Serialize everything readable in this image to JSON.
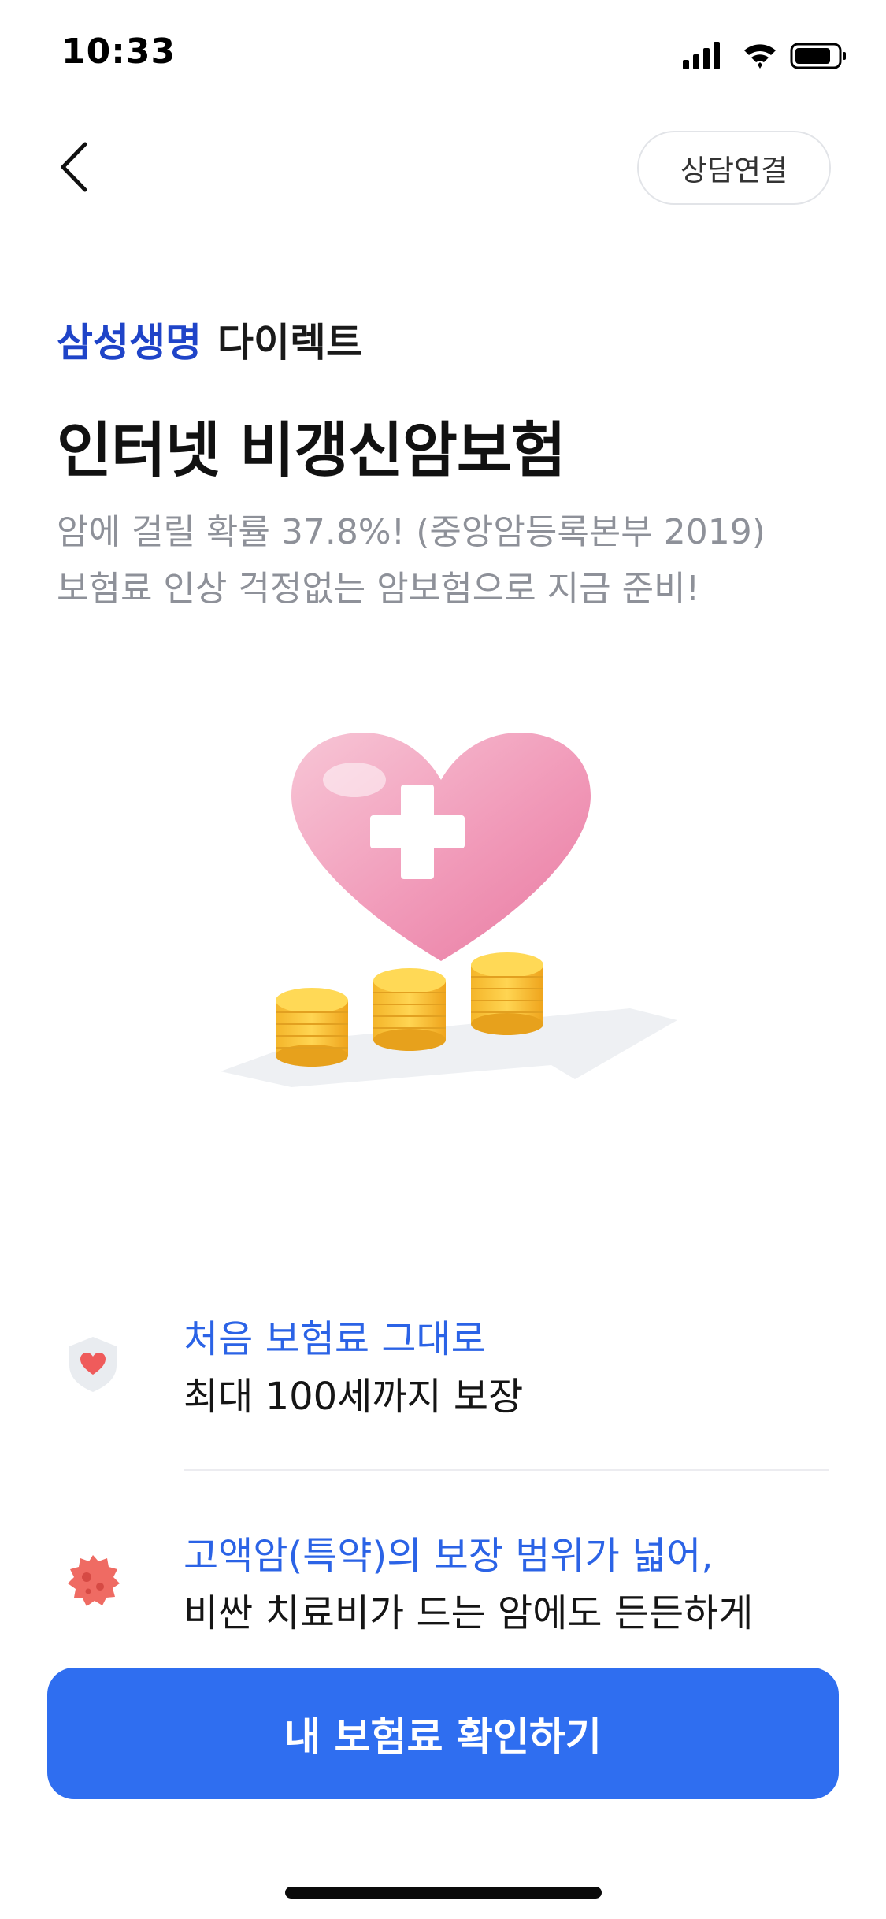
{
  "status_bar": {
    "time": "10:33"
  },
  "header": {
    "consult_label": "상담연결"
  },
  "brand": {
    "name": "삼성생명",
    "sub": "다이렉트"
  },
  "title": "인터넷 비갱신암보험",
  "subtitle": {
    "line1": "암에 걸릴 확률 37.8%! (중앙암등록본부 2019)",
    "line2": "보험료 인상 걱정없는 암보험으로 지금 준비!"
  },
  "features": [
    {
      "icon": "shield-heart-icon",
      "highlight": "처음 보험료 그대로",
      "text": "최대 100세까지 보장"
    },
    {
      "icon": "virus-cell-icon",
      "highlight": "고액암(특약)의 보장 범위가 넓어,",
      "text": "비싼 치료비가 드는 암에도 든든하게"
    }
  ],
  "cta": {
    "label": "내 보험료 확인하기"
  },
  "colors": {
    "brand": "#1f44c8",
    "accent": "#2f6ef0",
    "highlight": "#2b63e6",
    "muted": "#8e9199"
  }
}
